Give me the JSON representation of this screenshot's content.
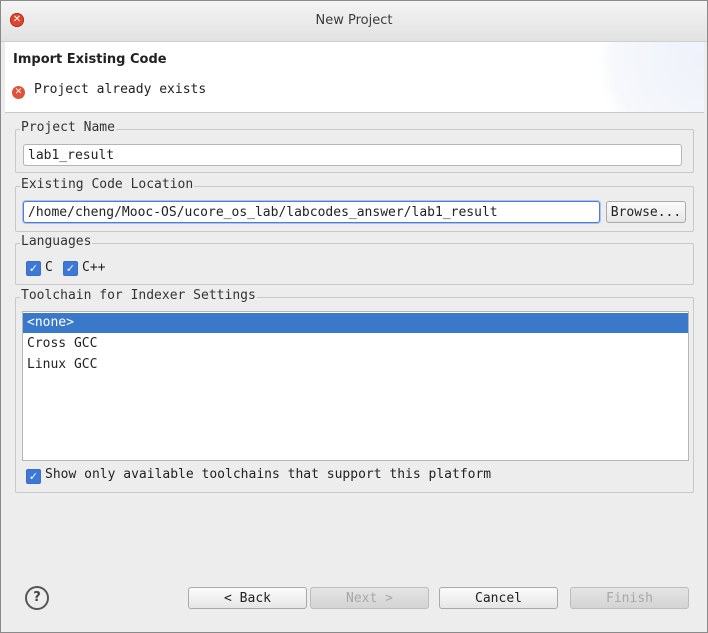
{
  "window": {
    "title": "New Project"
  },
  "header": {
    "title": "Import Existing Code",
    "error_message": "Project already exists"
  },
  "project_name": {
    "label": "Project Name",
    "value": "lab1_result"
  },
  "code_location": {
    "label": "Existing Code Location",
    "value": "/home/cheng/Mooc-OS/ucore_os_lab/labcodes_answer/lab1_result",
    "browse_label": "Browse..."
  },
  "languages": {
    "label": "Languages",
    "c_label": "C",
    "cpp_label": "C++",
    "c_checked": true,
    "cpp_checked": true
  },
  "toolchain": {
    "label": "Toolchain for Indexer Settings",
    "items": [
      "<none>",
      "Cross GCC",
      "Linux GCC"
    ],
    "selected": "<none>",
    "show_only_label": "Show only available toolchains that support this platform",
    "show_only_checked": true
  },
  "buttons": {
    "back": "< Back",
    "next": "Next >",
    "cancel": "Cancel",
    "finish": "Finish"
  },
  "colors": {
    "selection": "#3a78c9",
    "checkbox": "#3d78d8",
    "error": "#e0533a"
  }
}
